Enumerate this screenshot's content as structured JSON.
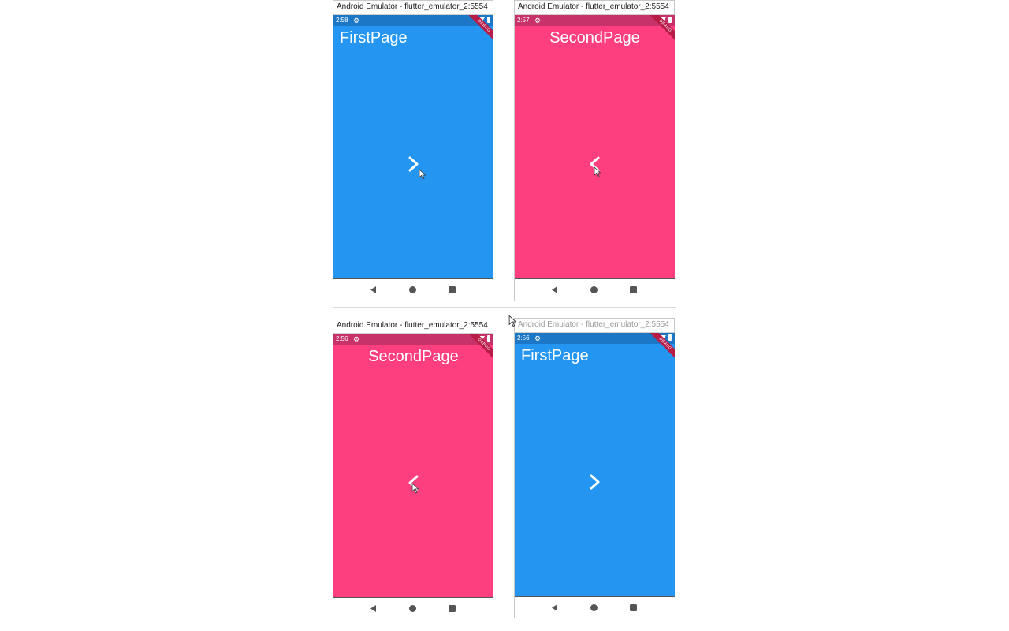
{
  "colors": {
    "first_page_bg": "#2496f2",
    "first_status_bg": "#1c78c6",
    "second_page_bg": "#fd3f7f",
    "second_status_bg": "#c8326a",
    "debug_ribbon": "#b71c47",
    "navbar_icon": "#555555"
  },
  "panels": [
    {
      "window_title": "Android Emulator - flutter_emulator_2:5554",
      "time": "2:58",
      "page_title": "FirstPage",
      "page": "first",
      "arrow_icon": "chevron-right-icon"
    },
    {
      "window_title": "Android Emulator - flutter_emulator_2:5554",
      "time": "2:57",
      "page_title": "SecondPage",
      "page": "second",
      "arrow_icon": "chevron-left-icon"
    },
    {
      "window_title": "Android Emulator - flutter_emulator_2:5554",
      "time": "2:56",
      "page_title": "SecondPage",
      "page": "second",
      "arrow_icon": "chevron-left-icon"
    },
    {
      "window_title": "Android Emulator - flutter_emulator_2:5554",
      "time": "2:56",
      "page_title": "FirstPage",
      "page": "first",
      "arrow_icon": "chevron-right-icon",
      "window_inactive": true
    }
  ],
  "debug_banner": "DEBUG",
  "icons": [
    "settings-gear-icon",
    "wifi-icon",
    "battery-icon",
    "back-icon",
    "home-icon",
    "recents-icon",
    "mouse-cursor-icon"
  ]
}
